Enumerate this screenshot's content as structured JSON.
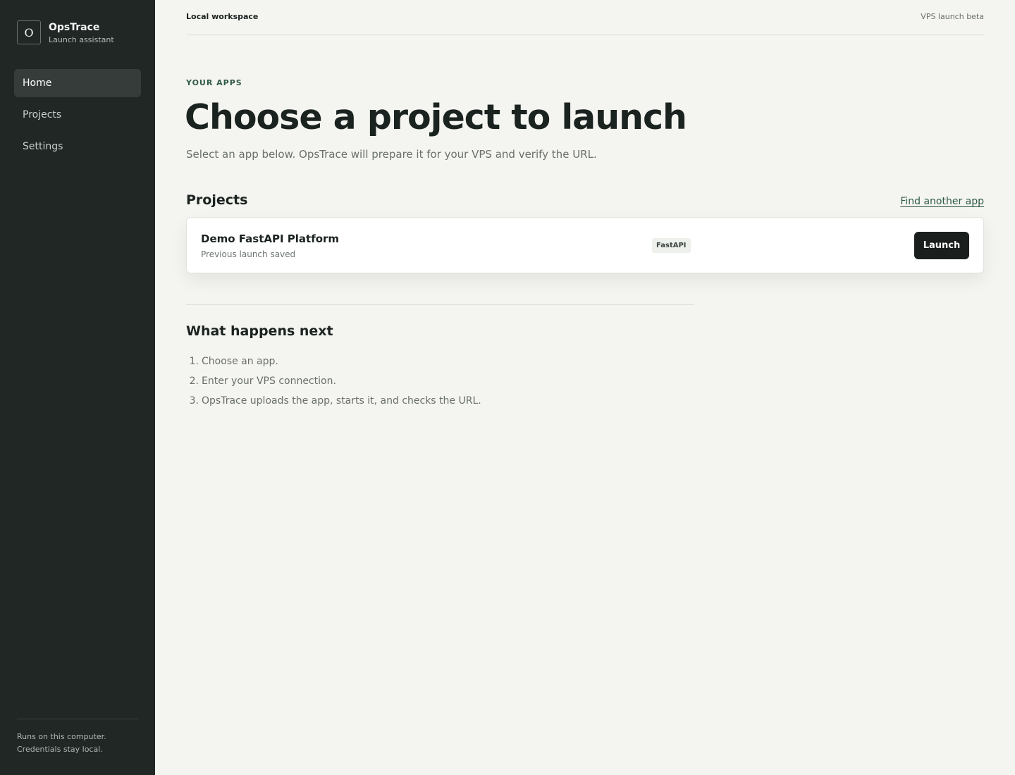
{
  "sidebar": {
    "brand": {
      "mark": "O",
      "name": "OpsTrace",
      "subtitle": "Launch assistant"
    },
    "items": [
      {
        "label": "Home",
        "active": true
      },
      {
        "label": "Projects",
        "active": false
      },
      {
        "label": "Settings",
        "active": false
      }
    ],
    "footer": {
      "line1": "Runs on this computer.",
      "line2": "Credentials stay local."
    }
  },
  "topbar": {
    "workspace": "Local workspace",
    "status": "VPS launch beta"
  },
  "main": {
    "eyebrow": "YOUR APPS",
    "title": "Choose a project to launch",
    "subtitle": "Select an app below. OpsTrace will prepare it for your VPS and verify the URL.",
    "projects_heading": "Projects",
    "find_link": "Find another app",
    "projects": [
      {
        "name": "Demo FastAPI Platform",
        "status": "Previous launch saved",
        "framework": "FastAPI",
        "action": "Launch"
      }
    ],
    "next": {
      "heading": "What happens next",
      "steps": [
        {
          "num": "1.",
          "text": "Choose an app."
        },
        {
          "num": "2.",
          "text": "Enter your VPS connection."
        },
        {
          "num": "3.",
          "text": "OpsTrace uploads the app, starts it, and checks the URL."
        }
      ]
    }
  },
  "colors": {
    "sidebar_bg": "#202724",
    "page_bg": "#f4f4f0",
    "accent": "#2e5a46",
    "button_bg": "#1a1f1d"
  }
}
